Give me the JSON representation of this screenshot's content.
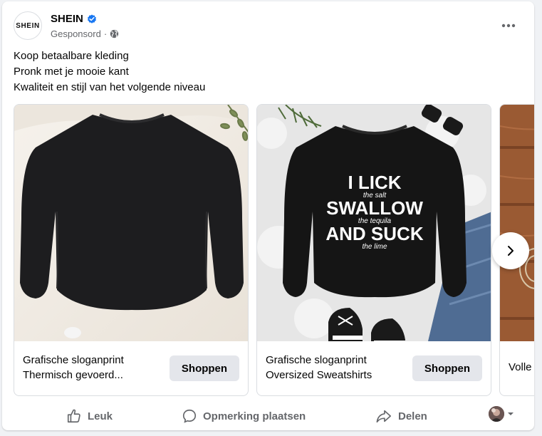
{
  "post": {
    "page_name": "SHEIN",
    "avatar_text": "SHEIN",
    "sponsored_label": "Gesponsord",
    "separator": "·",
    "text_lines": [
      "Koop betaalbare kleding",
      "Pronk met je mooie kant",
      "Kwaliteit en stijl van het volgende niveau"
    ]
  },
  "carousel": {
    "cards": [
      {
        "title_lines": [
          "Grafische sloganprint",
          "Thermisch gevoerd..."
        ],
        "button_label": "Shoppen"
      },
      {
        "title_lines": [
          "Grafische sloganprint",
          "Oversized Sweatshirts"
        ],
        "button_label": "Shoppen",
        "shirt_print": {
          "line1": "I LICK",
          "line2": "the salt",
          "line3": "SWALLOW",
          "line4": "the tequila",
          "line5": "AND SUCK",
          "line6": "the lime"
        }
      },
      {
        "title_lines": [
          "Volle"
        ]
      }
    ]
  },
  "actions": {
    "like": "Leuk",
    "comment": "Opmerking plaatsen",
    "share": "Delen"
  },
  "colors": {
    "verified": "#1877f2",
    "secondary_text": "#65676b",
    "button_bg": "#e4e6eb"
  }
}
